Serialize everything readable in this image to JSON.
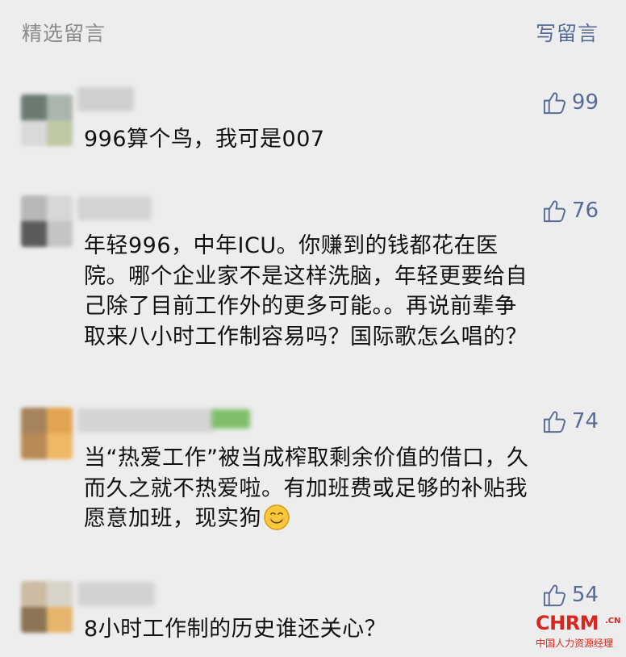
{
  "header": {
    "section_title": "精选留言",
    "write_comment_label": "写留言"
  },
  "comments": [
    {
      "likes": "99",
      "text": "996算个鸟，我可是007"
    },
    {
      "likes": "76",
      "lines": [
        "年轻996，中年ICU。你赚到的钱都花在医",
        "院。哪个企业家不是这样洗脑，年轻更要给自",
        "己除了目前工作外的更多可能。。再说前辈争",
        "取来八小时工作制容易吗？国际歌怎么唱的？"
      ]
    },
    {
      "likes": "74",
      "lines": [
        "当“热爱工作”被当成榨取剩余价值的借口，久",
        "而久之就不热爱啦。有加班费或足够的补贴我",
        "愿意加班，现实狗"
      ],
      "emoji": "smile-emoji"
    },
    {
      "likes": "54",
      "text": "8小时工作制的历史谁还关心？"
    }
  ],
  "watermark": {
    "logo": "CHRM",
    "suffix": ".CN",
    "subtitle": "中国人力资源经理"
  },
  "colors": {
    "background": "#ededed",
    "link": "#576b95",
    "muted": "#8a8a8a",
    "text": "#111111",
    "watermark": "#d8261f"
  }
}
